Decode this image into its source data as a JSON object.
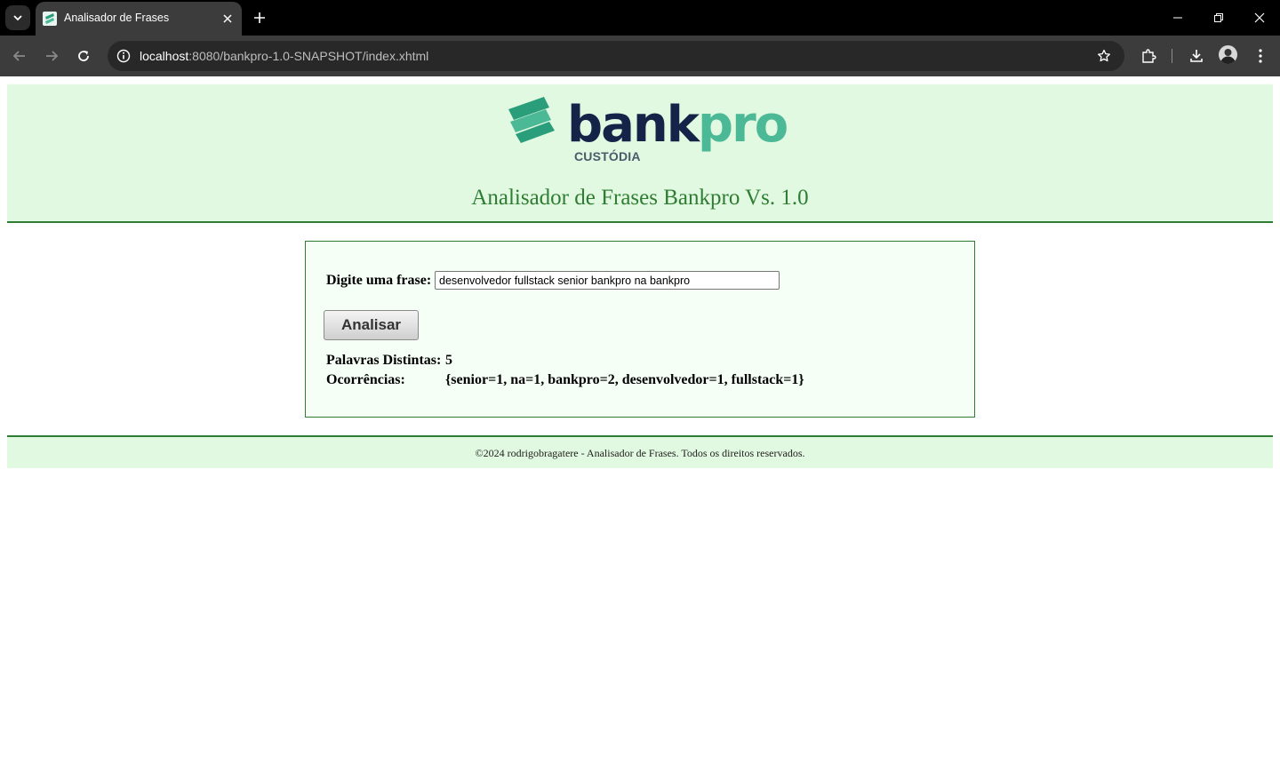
{
  "browser": {
    "tab_title": "Analisador de Frases",
    "url_host": "localhost",
    "url_path": ":8080/bankpro-1.0-SNAPSHOT/index.xhtml"
  },
  "header": {
    "logo_bank": "bank",
    "logo_pro": "pro",
    "logo_sub": "CUSTÓDIA",
    "title": "Analisador de Frases Bankpro Vs. 1.0"
  },
  "form": {
    "label": "Digite uma frase:",
    "input_value": "desenvolvedor fullstack senior bankpro na bankpro",
    "button_label": "Analisar"
  },
  "results": {
    "distinct_label": "Palavras Distintas:",
    "distinct_value": "5",
    "occurrences_label": "Ocorrências:",
    "occurrences_value": "{senior=1, na=1, bankpro=2, desenvolvedor=1, fullstack=1}"
  },
  "footer": {
    "text": "©2024 rodrigobragatere - Analisador de Frases. Todos os direitos reservados."
  },
  "colors": {
    "header_bg": "#e1f8e1",
    "accent_green": "#2e7d32",
    "logo_navy": "#142448",
    "logo_teal": "#4bb896"
  }
}
